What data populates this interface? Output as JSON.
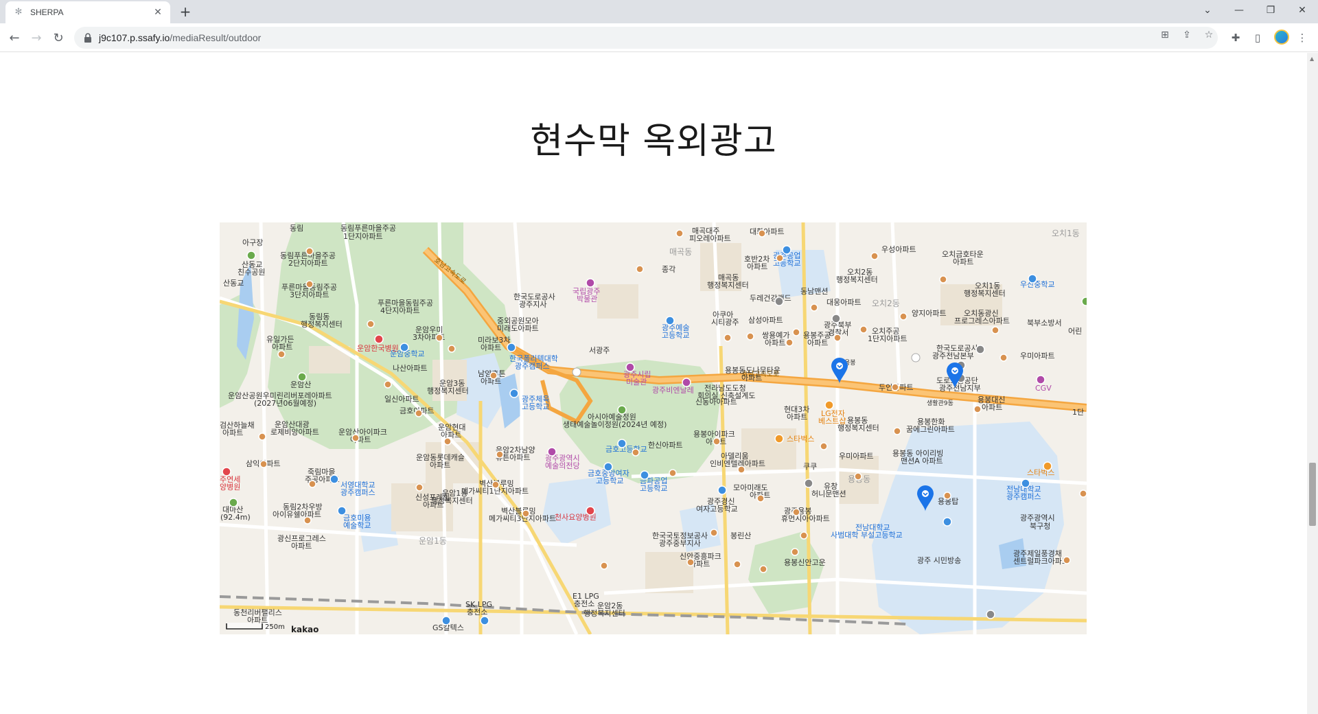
{
  "browser": {
    "tab_title": "SHERPA",
    "url_host": "j9c107.p.ssafy.io",
    "url_path": "/mediaResult/outdoor"
  },
  "page": {
    "title": "현수막 옥외광고"
  },
  "map": {
    "scale_label": "250m",
    "logo": "kakao",
    "markers": 3,
    "labels": {
      "dongrim": "동림",
      "dongrim_purun1": "동림푸른마을주공",
      "dongrim_purun1b": "1단지아파트",
      "aguj": "아구장",
      "sangdonggyo": "산동교",
      "sangdonggyo2": "친수공원",
      "purun2": "동림푸른마을주공",
      "purun2b": "2단지아파트",
      "sandonggyo_road": "산동교",
      "purun3": "푸른마을동림주공",
      "purun3b": "3단지아파트",
      "dongrimdong": "동림동",
      "dongrimdong2": "행정복지센터",
      "purun4": "푸른마을동림주공",
      "purun4b": "4단지아파트",
      "yuil": "유일가든",
      "yuil2": "아파트",
      "unam_hospital": "운암한국병원",
      "unam_mountain": "운암산",
      "unamsan_park": "운암산공원우미린리버포레아파트",
      "unamsan_park2": "(2027년06월예정)",
      "geumsan": "검산하늘채",
      "geumsan2": "아파트",
      "unamsandaewang": "운암산대광",
      "unamsandaewang2": "로제비앙아파트",
      "samik": "삼익아파트",
      "jukrim": "죽림마을",
      "jukrim2": "주공아파트",
      "juyeonse": "주연세",
      "juyeonse2": "양병원",
      "daemasan": "대마산",
      "daemasan2": "(92.4m)",
      "dongrim2cha": "동림2차우방",
      "dongrim2cha2": "아이유쉘아파트",
      "gwangsin": "광신프로그레스",
      "gwangsin2": "아파트",
      "dongcheon": "동천리버팰리스",
      "dongcheon2": "아파트",
      "unam_umi": "운암우미",
      "unam_umi2": "3차아파트",
      "unam_middle": "운암중학교",
      "naksan": "나산아파트",
      "ilsin": "일신아파트",
      "geumho": "금호아파트",
      "unam3dong": "운암3동",
      "unam3dong2": "행정복지센터",
      "unamsanaipark": "운암산아이파크",
      "unamsanaipark2": "아파트",
      "seoyoung": "서영대학교",
      "seoyoung2": "광주캠퍼스",
      "geumhoimiyong": "금호미용",
      "geumhoimiyong2": "예술학교",
      "sinseongpohil": "신성포레힐",
      "sinseongpohil2": "아파트",
      "unam1dong": "운암1동",
      "unam1dong2": "행정복지센터",
      "unam1dong_g": "운암1동",
      "unamdong_rotte": "운암동롯데캐슬",
      "unamdong_rotte2": "아파트",
      "unam_hyundai": "운암현대",
      "unam_hyundai2": "아파트",
      "namyang": "남양휴튼",
      "namyang2": "아파트",
      "mirabo": "미라보3차",
      "mirabo2": "아파트",
      "junghwe": "중외공원모아",
      "junghwe2": "미래도아파트",
      "hanguk_road": "한국도로공사",
      "hanguk_road2": "광주지사",
      "hanguk_poly": "한국폴리텍대학",
      "hanguk_poly2": "광주캠퍼스",
      "gwangju_sports": "광주체육",
      "gwangju_sports2": "고등학교",
      "unam2cha": "운암2차남양",
      "unam2cha2": "휴튼아파트",
      "byeoksan1": "벽산블루밍",
      "byeoksan1b": "메가씨티1단지아파트",
      "byeoksan3": "벽산블루밍",
      "byeoksan3b": "메가씨티3단지아파트",
      "gwangju_art_hall": "광주광역시",
      "gwangju_art_hall2": "예술의전당",
      "cheonsa": "천사요양병원",
      "unam2dong": "운암2동",
      "unam2dong2": "행정복지센터",
      "e1lpg": "E1 LPG",
      "e1lpg2": "충전소",
      "sklpg": "SK LPG",
      "sklpg2": "충전소",
      "gs": "GS칼텍스",
      "national_museum": "국립광주",
      "national_museum2": "박물관",
      "seogwangju": "서광주",
      "gwangju_art_museum": "광주시립",
      "gwangju_art_museum2": "미술관",
      "biennale": "광주비엔날레",
      "jeonrado": "전라남도도청",
      "jeonrado2": "회의실 신축설계도",
      "asia_park": "아시아예술정원",
      "asia_park2": "생태예술놀이정원(2024년 예정)",
      "hansin": "한신아파트",
      "geumho_high": "금호고등학교",
      "geumho_girls": "금호중앙여자",
      "geumho_girls2": "고등학교",
      "geumpa": "금파공업",
      "geumpa2": "고등학교",
      "arts_high": "광주예술",
      "arts_high2": "고등학교",
      "ssangyong": "쌍용예가",
      "ssangyong2": "아파트",
      "akuya": "아쿠아",
      "akuya2": "시티광주",
      "samsung": "삼성아파트",
      "yongbongjugong": "용봉주공",
      "yongbongjugong2": "아파트",
      "yongbong_purun": "용봉동도나무타운",
      "yongbong_purun2": "아파트",
      "sindong": "신동아아파트",
      "hyundai3": "현대3차",
      "hyundai3b": "아파트",
      "yongbong_ipark": "용봉아이파크",
      "yongbong_ipark2": "아파트",
      "adellium": "아델리움",
      "adellium2": "인비엔텔레아파트",
      "mamyeong": "모아미래도",
      "mamyeong2": "아파트",
      "gyeongsin": "광주경신",
      "gyeongsin2": "여자고등학교",
      "bongsan": "봉린산",
      "hanguk_land": "한국국토정보공사",
      "hanguk_land2": "광주중부지사",
      "sinan": "신안중흥파크",
      "sinan2": "아파트",
      "yongbong_heum": "광주용봉",
      "yongbong_heum2": "휴먼시아아파트",
      "yongbong_sinan": "용봉신안고운",
      "kuku": "쿠쿠",
      "yuchang": "유창",
      "yuchang2": "허니문맨션",
      "lg": "LG전자",
      "lg2": "베스트샵",
      "starbucks1": "스타벅스",
      "umi_apt": "우미아파트",
      "yongbongdong": "용봉동",
      "yongbongdong2": "행정복지센터",
      "yongbong_g": "용봉동",
      "yongbong_hanwha": "용봉한화",
      "yongbong_hanwha2": "꿈에그린아파트",
      "yongbong_irib": "용봉동 아이리빙",
      "yongbong_irib2": "맨션A 아파트",
      "yongbongtap": "용봉탑",
      "jnu": "전남대학교",
      "jnu2": "광주캠퍼스",
      "jnu_high": "전남대학교",
      "jnu_high2": "사범대학 부설고등학교",
      "buk_office": "광주광역시",
      "buk_office2": "북구청",
      "jeil": "광주제일풍경채",
      "jeil2": "센트럴파크아파트",
      "gwangju_sibangsong": "광주 시민방송",
      "maegokdaeju": "매곡대주",
      "maegokdaeju2": "피오레아파트",
      "daehwa": "대화아파트",
      "maegok_g": "매곡동",
      "jonggak": "종각",
      "maegokdong": "매곡동",
      "maegokdong2": "행정복지센터",
      "hobin2": "호반2차",
      "hobin2b": "아파트",
      "gwangju_industrial": "광주공업",
      "gwangju_industrial2": "고등학교",
      "dureh": "두레건강랜드",
      "dongnam": "동남맨션",
      "daewoong": "대웅아파트",
      "ochi2dong": "오치2동",
      "ochi2dong2": "행정복지센터",
      "ochi2_g": "오치2동",
      "woosung": "우성아파트",
      "ochi_geumho": "오치금호타운",
      "ochi_geumho2": "아파트",
      "ochi1dong": "오치1동",
      "ochi1dong2": "행정복지센터",
      "ochi1_g": "오치1동",
      "usan_middle": "우산중학교",
      "yangji": "양지아파트",
      "ochi_gwangsin": "오치동광신",
      "ochi_gwangsin2": "프로그레스아파트",
      "buk_fire": "북부소방서",
      "gwangju_north_police": "광주북부",
      "gwangju_north_police2": "경찰서",
      "ochi_jugong": "오치주공",
      "ochi_jugong2": "1단지아파트",
      "hanguk_road_hq": "한국도로공사",
      "hanguk_road_hq2": "광주전남본부",
      "umi2": "우미아파트",
      "tuin": "두인아파트",
      "road_traffic": "도로교통공단",
      "road_traffic2": "광주전남지부",
      "cgv": "CGV",
      "yongbong_daesin": "용봉대신",
      "yongbong_daesin2": "아파트",
      "saenghwal": "생활관9동",
      "starbucks2": "스타벅스",
      "yongbong_ic": "용봉",
      "honam_expressway": "호남고속도로",
      "honam_expressway2": "호남고속도로",
      "eorin": "어린",
      "one_dan": "1단"
    }
  }
}
